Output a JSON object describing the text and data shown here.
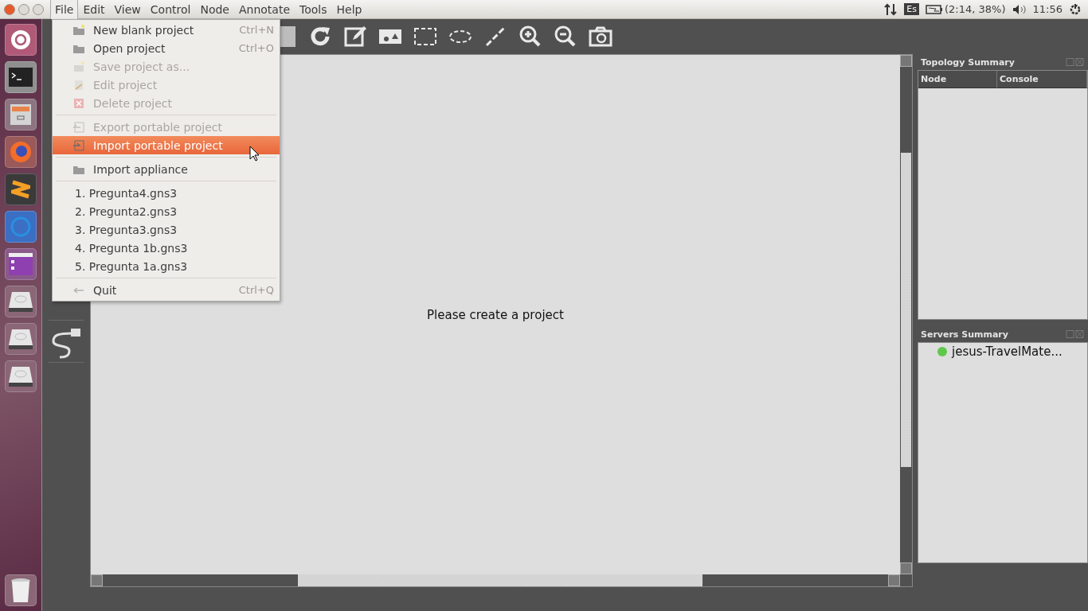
{
  "menubar": [
    {
      "label": "File",
      "selected": true
    },
    {
      "label": "Edit",
      "selected": false
    },
    {
      "label": "View",
      "selected": false
    },
    {
      "label": "Control",
      "selected": false
    },
    {
      "label": "Node",
      "selected": false
    },
    {
      "label": "Annotate",
      "selected": false
    },
    {
      "label": "Tools",
      "selected": false
    },
    {
      "label": "Help",
      "selected": false
    }
  ],
  "indicators": {
    "keyboard": "Es",
    "battery": "(2:14, 38%)",
    "clock": "11:56"
  },
  "file_menu": [
    {
      "kind": "action",
      "label": "New blank project",
      "shortcut": "Ctrl+N",
      "disabled": false,
      "selected": false
    },
    {
      "kind": "action",
      "label": "Open project",
      "shortcut": "Ctrl+O",
      "disabled": false,
      "selected": false
    },
    {
      "kind": "action",
      "label": "Save project as...",
      "disabled": true,
      "selected": false
    },
    {
      "kind": "action",
      "label": "Edit project",
      "disabled": true,
      "selected": false
    },
    {
      "kind": "action",
      "label": "Delete project",
      "disabled": true,
      "selected": false
    },
    {
      "kind": "separator"
    },
    {
      "kind": "action",
      "label": "Export portable project",
      "disabled": true,
      "selected": false
    },
    {
      "kind": "action",
      "label": "Import portable project",
      "disabled": false,
      "selected": true
    },
    {
      "kind": "separator"
    },
    {
      "kind": "action",
      "label": "Import appliance",
      "disabled": false,
      "selected": false
    },
    {
      "kind": "separator"
    },
    {
      "kind": "recent",
      "label": "1. Pregunta4.gns3",
      "disabled": false,
      "selected": false
    },
    {
      "kind": "recent",
      "label": "2. Pregunta2.gns3",
      "disabled": false,
      "selected": false
    },
    {
      "kind": "recent",
      "label": "3. Pregunta3.gns3",
      "disabled": false,
      "selected": false
    },
    {
      "kind": "recent",
      "label": "4. Pregunta 1b.gns3",
      "disabled": false,
      "selected": false
    },
    {
      "kind": "recent",
      "label": "5. Pregunta 1a.gns3",
      "disabled": false,
      "selected": false
    },
    {
      "kind": "separator"
    },
    {
      "kind": "action",
      "label": "Quit",
      "shortcut": "Ctrl+Q",
      "disabled": false,
      "selected": false
    }
  ],
  "canvas": {
    "message": "Please create a project"
  },
  "topology_summary": {
    "title": "Topology Summary",
    "columns": [
      "Node",
      "Console"
    ]
  },
  "servers_summary": {
    "title": "Servers Summary",
    "servers": [
      {
        "name": "jesus-TravelMate...",
        "color": "#5fc84a"
      }
    ]
  }
}
